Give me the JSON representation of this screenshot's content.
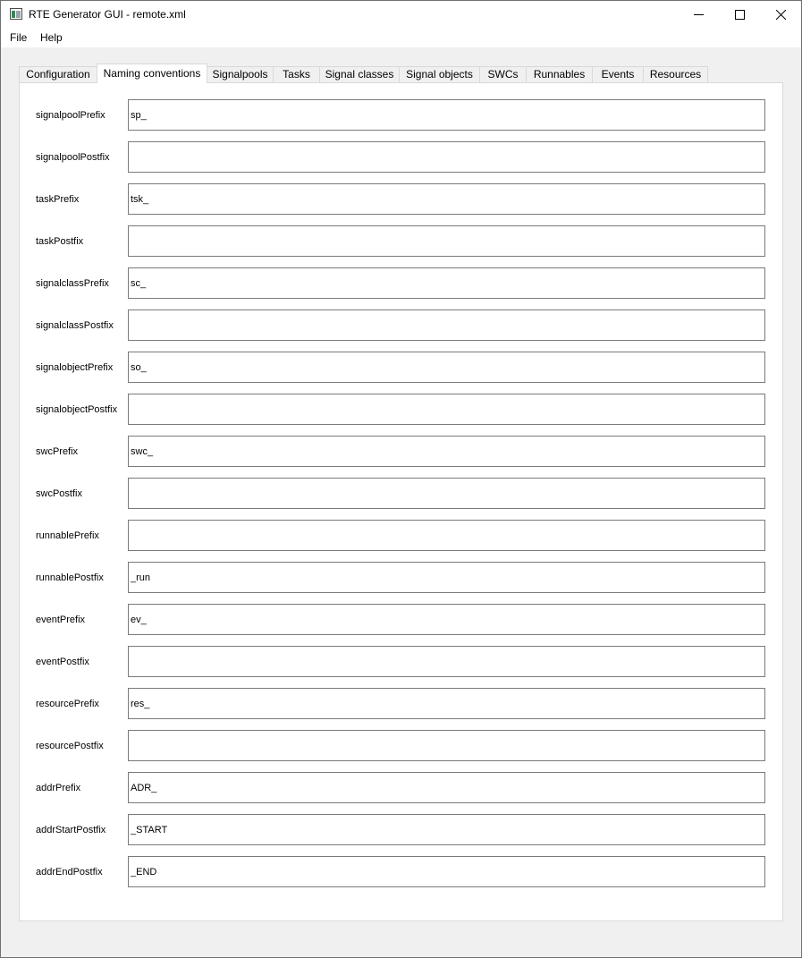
{
  "window": {
    "title": "RTE Generator GUI - remote.xml",
    "icon": "app-icon"
  },
  "menu": {
    "file": "File",
    "help": "Help"
  },
  "tabs": [
    {
      "label": "Configuration",
      "active": false
    },
    {
      "label": "Naming conventions",
      "active": true
    },
    {
      "label": "Signalpools",
      "active": false
    },
    {
      "label": "Tasks",
      "active": false
    },
    {
      "label": "Signal classes",
      "active": false
    },
    {
      "label": "Signal objects",
      "active": false
    },
    {
      "label": "SWCs",
      "active": false
    },
    {
      "label": "Runnables",
      "active": false
    },
    {
      "label": "Events",
      "active": false
    },
    {
      "label": "Resources",
      "active": false
    }
  ],
  "fields": [
    {
      "label": "signalpoolPrefix",
      "value": "sp_"
    },
    {
      "label": "signalpoolPostfix",
      "value": ""
    },
    {
      "label": "taskPrefix",
      "value": "tsk_"
    },
    {
      "label": "taskPostfix",
      "value": ""
    },
    {
      "label": "signalclassPrefix",
      "value": "sc_"
    },
    {
      "label": "signalclassPostfix",
      "value": ""
    },
    {
      "label": "signalobjectPrefix",
      "value": "so_"
    },
    {
      "label": "signalobjectPostfix",
      "value": ""
    },
    {
      "label": "swcPrefix",
      "value": "swc_"
    },
    {
      "label": "swcPostfix",
      "value": ""
    },
    {
      "label": "runnablePrefix",
      "value": ""
    },
    {
      "label": "runnablePostfix",
      "value": "_run"
    },
    {
      "label": "eventPrefix",
      "value": "ev_"
    },
    {
      "label": "eventPostfix",
      "value": ""
    },
    {
      "label": "resourcePrefix",
      "value": "res_"
    },
    {
      "label": "resourcePostfix",
      "value": ""
    },
    {
      "label": "addrPrefix",
      "value": "ADR_"
    },
    {
      "label": "addrStartPostfix",
      "value": "_START"
    },
    {
      "label": "addrEndPostfix",
      "value": "_END"
    }
  ]
}
